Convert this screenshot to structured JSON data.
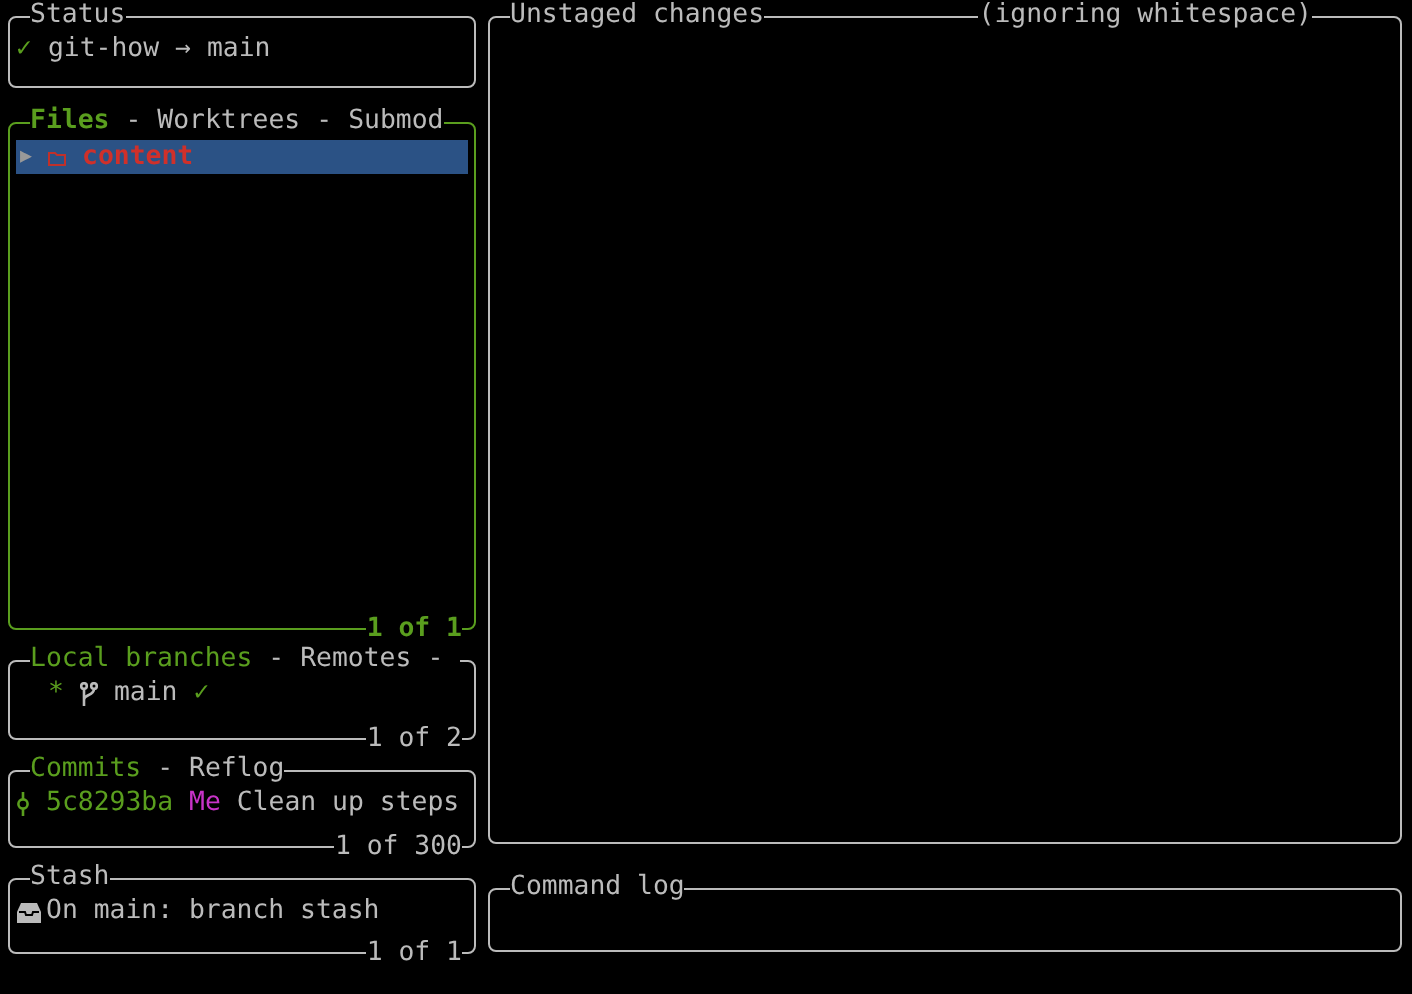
{
  "status": {
    "title": "Status",
    "icon": "✓",
    "repo": "git-how",
    "arrow": "→",
    "branch": "main"
  },
  "files": {
    "focused": true,
    "separator": "-",
    "trailing_separator": false,
    "tabs": [
      {
        "label": "Files",
        "selected": true
      },
      {
        "label": "Worktrees",
        "selected": false
      },
      {
        "label": "Submod",
        "selected": false
      }
    ],
    "items": [
      {
        "toggle": "▶",
        "kind": "folder",
        "name": "content",
        "selected": true
      }
    ],
    "footer": "1 of 1"
  },
  "branches": {
    "focused": false,
    "separator": "-",
    "trailing_separator": true,
    "tabs": [
      {
        "label": "Local branches",
        "selected": true
      },
      {
        "label": "Remotes",
        "selected": false
      }
    ],
    "items": [
      {
        "marker": "*",
        "name": "main",
        "status": "✓"
      }
    ],
    "footer": "1 of 2"
  },
  "commits": {
    "focused": false,
    "separator": "-",
    "trailing_separator": false,
    "tabs": [
      {
        "label": "Commits",
        "selected": true
      },
      {
        "label": "Reflog",
        "selected": false
      }
    ],
    "items": [
      {
        "hash": "5c8293ba",
        "author": "Me",
        "message": "Clean up steps"
      }
    ],
    "footer": "1 of 300"
  },
  "stash": {
    "title": "Stash",
    "items": [
      {
        "text": "On main: branch stash"
      }
    ],
    "footer": "1 of 1"
  },
  "main": {
    "title": "Unstaged changes",
    "subtitle": "(ignoring whitespace)"
  },
  "command_log": {
    "title": "Command log"
  }
}
